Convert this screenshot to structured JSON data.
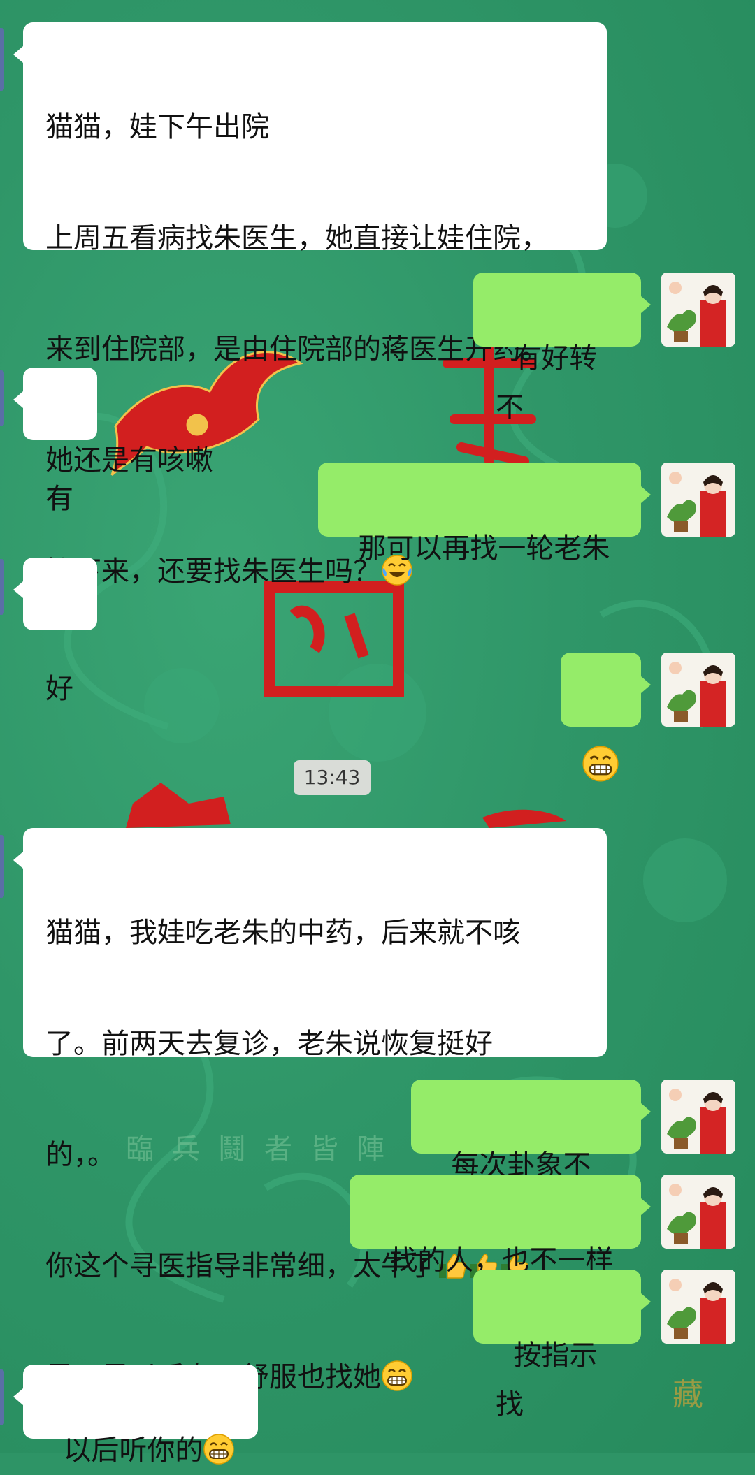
{
  "background": {
    "color": "#2e9466",
    "motif_color": "#d21f1f",
    "faint_caption": "臨兵鬪者皆陣",
    "corner_glyph": "藏"
  },
  "colors": {
    "incoming_bubble": "#ffffff",
    "outgoing_bubble": "#95ec69",
    "timestamp_bg": "#d9dcd7"
  },
  "messages": [
    {
      "side": "in",
      "lines": [
        "猫猫，娃下午出院",
        "上周五看病找朱医生，她直接让娃住院，",
        "来到住院部，是由住院部的蒋医生开药。",
        "她还是有咳嗽",
        "接下来，还要找朱医生吗？"
      ],
      "emoji": "tears-of-joy"
    },
    {
      "side": "out",
      "text": "有好转不"
    },
    {
      "side": "in",
      "text": "有"
    },
    {
      "side": "out",
      "text": "那可以再找一轮老朱"
    },
    {
      "side": "in",
      "text": "好"
    },
    {
      "side": "out",
      "emoji": "grin"
    },
    {
      "side": "in",
      "lines": [
        "猫猫，我娃吃老朱的中药，后来就不咳",
        "了。前两天去复诊，老朱说恢复挺好",
        "的，。",
        "你这个寻医指导非常细，太牛了",
        "是不是以后有不舒服也找她"
      ]
    },
    {
      "side": "out",
      "text": "每次卦象不同"
    },
    {
      "side": "out",
      "text": "找的人，也不一样"
    },
    {
      "side": "out",
      "text": "按指示找"
    },
    {
      "side": "in",
      "text": "以后听你的"
    }
  ],
  "timestamp": "13:43"
}
